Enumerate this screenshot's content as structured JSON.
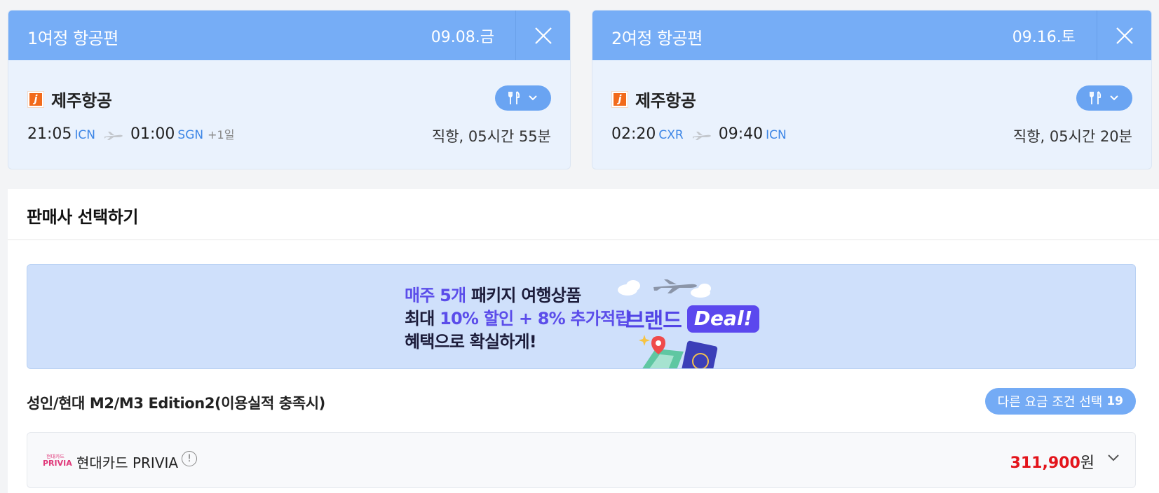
{
  "legs": [
    {
      "title": "1여정 항공편",
      "date": "09.08.금",
      "airline": "제주항공",
      "airline_logo": "j",
      "dep_time": "21:05",
      "dep_code": "ICN",
      "arr_time": "01:00",
      "arr_code": "SGN",
      "day_offset": "+1일",
      "duration": "직항, 05시간 55분"
    },
    {
      "title": "2여정 항공편",
      "date": "09.16.토",
      "airline": "제주항공",
      "airline_logo": "j",
      "dep_time": "02:20",
      "dep_code": "CXR",
      "arr_time": "09:40",
      "arr_code": "ICN",
      "day_offset": "",
      "duration": "직항, 05시간 20분"
    }
  ],
  "section": {
    "title": "판매사 선택하기"
  },
  "banner": {
    "line1_hl": "매주 5개",
    "line1_rest": " 패키지 여행상품",
    "line2_pre": "최대 ",
    "line2_hl": "10% 할인 + 8% 추가적립",
    "line3": "혜택으로 확실하게!",
    "brand": "브랜드",
    "deal": "Deal!"
  },
  "fare": {
    "label": "성인/현대 M2/M3 Edition2(이용실적 충족시)",
    "other_button": "다른 요금 조건 선택",
    "other_count": "19"
  },
  "vendor": {
    "logo_line1": "현대카드",
    "logo_line2": "PRIVIA",
    "name": "현대카드 PRIVIA",
    "info": "!",
    "price": "311,900",
    "price_unit": "원"
  },
  "colors": {
    "header_blue": "#76adf6",
    "card_bg": "#eaf2fd",
    "code_blue": "#3d86e6",
    "price_red": "#e3141b",
    "deal_purple": "#5b48ee"
  },
  "icons": [
    "close-icon",
    "meal-icon",
    "chevron-down-icon",
    "plane-icon",
    "info-icon"
  ]
}
